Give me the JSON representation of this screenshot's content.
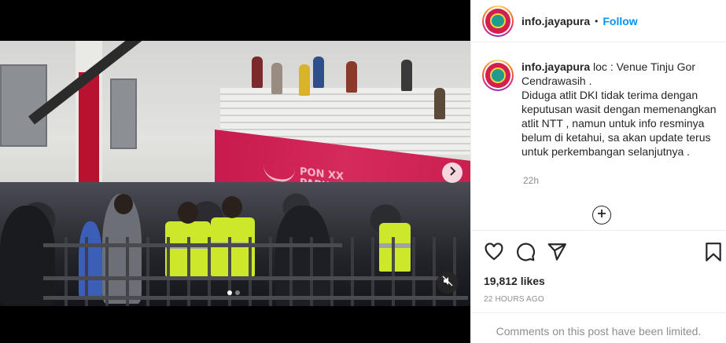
{
  "post": {
    "username": "info.jayapura",
    "separator": "•",
    "follow_label": "Follow",
    "caption_lead": "loc : Venue Tinju Gor Cendrawasih .",
    "caption_body": "Diduga atlit DKI tidak terima dengan keputusan wasit dengan memenangkan atlit NTT , namun untuk info resminya belum di ketahui, sa akan update terus untuk perkembangan selanjutnya .",
    "caption_time": "22h",
    "likes": "19,812 likes",
    "timestamp": "22 HOURS AGO",
    "comments_notice": "Comments on this post have been limited."
  },
  "media": {
    "banner_text_line1": "PON XX",
    "banner_text_line2": "PAPUA",
    "carousel_total": 2,
    "carousel_active": 1
  },
  "icons": {
    "next": "chevron-right-icon",
    "mute": "muted-speaker-icon",
    "add": "plus-circle-icon",
    "like": "heart-icon",
    "comment": "speech-bubble-icon",
    "share": "paper-plane-icon",
    "save": "bookmark-icon"
  },
  "colors": {
    "accent": "#0095f6",
    "text": "#262626",
    "muted": "#8e8e8e"
  }
}
